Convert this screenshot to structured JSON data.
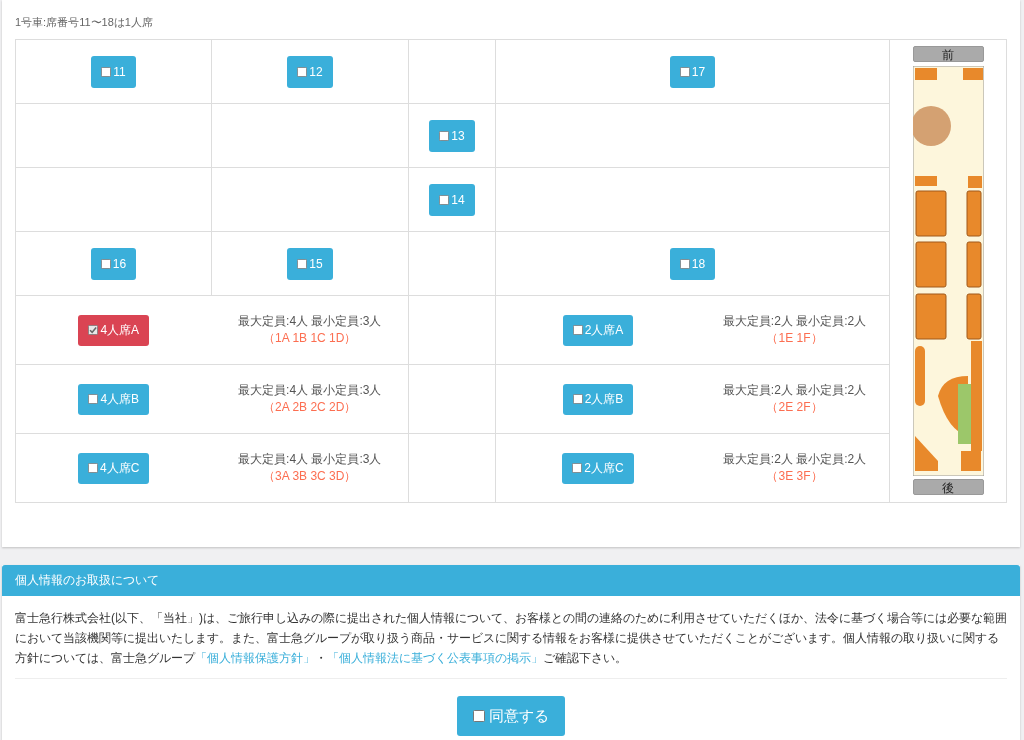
{
  "caption": "1号車:席番号11〜18は1人席",
  "single_seat_rows": [
    {
      "cells": [
        {
          "kind": "seat",
          "label": "11",
          "checked": false
        },
        {
          "kind": "seat",
          "label": "12",
          "checked": false
        },
        {
          "kind": "empty"
        },
        {
          "kind": "seat",
          "label": "17",
          "checked": false
        }
      ]
    },
    {
      "cells": [
        {
          "kind": "empty"
        },
        {
          "kind": "empty"
        },
        {
          "kind": "seat",
          "label": "13",
          "checked": false
        },
        {
          "kind": "empty"
        }
      ]
    },
    {
      "cells": [
        {
          "kind": "empty"
        },
        {
          "kind": "empty"
        },
        {
          "kind": "seat",
          "label": "14",
          "checked": false
        },
        {
          "kind": "empty"
        }
      ]
    },
    {
      "cells": [
        {
          "kind": "seat",
          "label": "16",
          "checked": false
        },
        {
          "kind": "seat",
          "label": "15",
          "checked": false
        },
        {
          "kind": "empty"
        },
        {
          "kind": "seat",
          "label": "18",
          "checked": false
        }
      ]
    }
  ],
  "group_seat_rows": [
    {
      "left": {
        "label": "4人席A",
        "checked": true,
        "capacity": "最大定員:4人 最小定員:3人",
        "seats": "（1A 1B 1C 1D）"
      },
      "right": {
        "label": "2人席A",
        "checked": false,
        "capacity": "最大定員:2人 最小定員:2人",
        "seats": "（1E 1F）"
      }
    },
    {
      "left": {
        "label": "4人席B",
        "checked": false,
        "capacity": "最大定員:4人 最小定員:3人",
        "seats": "（2A 2B 2C 2D）"
      },
      "right": {
        "label": "2人席B",
        "checked": false,
        "capacity": "最大定員:2人 最小定員:2人",
        "seats": "（2E 2F）"
      }
    },
    {
      "left": {
        "label": "4人席C",
        "checked": false,
        "capacity": "最大定員:4人 最小定員:3人",
        "seats": "（3A 3B 3C 3D）"
      },
      "right": {
        "label": "2人席C",
        "checked": false,
        "capacity": "最大定員:2人 最小定員:2人",
        "seats": "（3E 3F）"
      }
    }
  ],
  "car_map": {
    "front_label": "前",
    "rear_label": "後",
    "kind": "picture"
  },
  "privacy": {
    "title": "個人情報のお取扱について",
    "body": [
      {
        "kind": "text",
        "text": "富士急行株式会社(以下、「当社」)は、ご旅行申し込みの際に提出された個人情報について、お客様との間の連絡のために利用させていただくほか、法令に基づく場合等には必要な範囲において当該機関等に提出いたします。また、富士急グループが取り扱う商品・サービスに関する情報をお客様に提供させていただくことがございます。個人情報の取り扱いに関する方針については、富士急グループ"
      },
      {
        "kind": "link",
        "text": "「個人情報保護方針」"
      },
      {
        "kind": "text",
        "text": "・"
      },
      {
        "kind": "link",
        "text": "「個人情報法に基づく公表事項の掲示」"
      },
      {
        "kind": "text",
        "text": "ご確認下さい。"
      }
    ],
    "agree": {
      "label": "同意する",
      "checked": false
    }
  }
}
